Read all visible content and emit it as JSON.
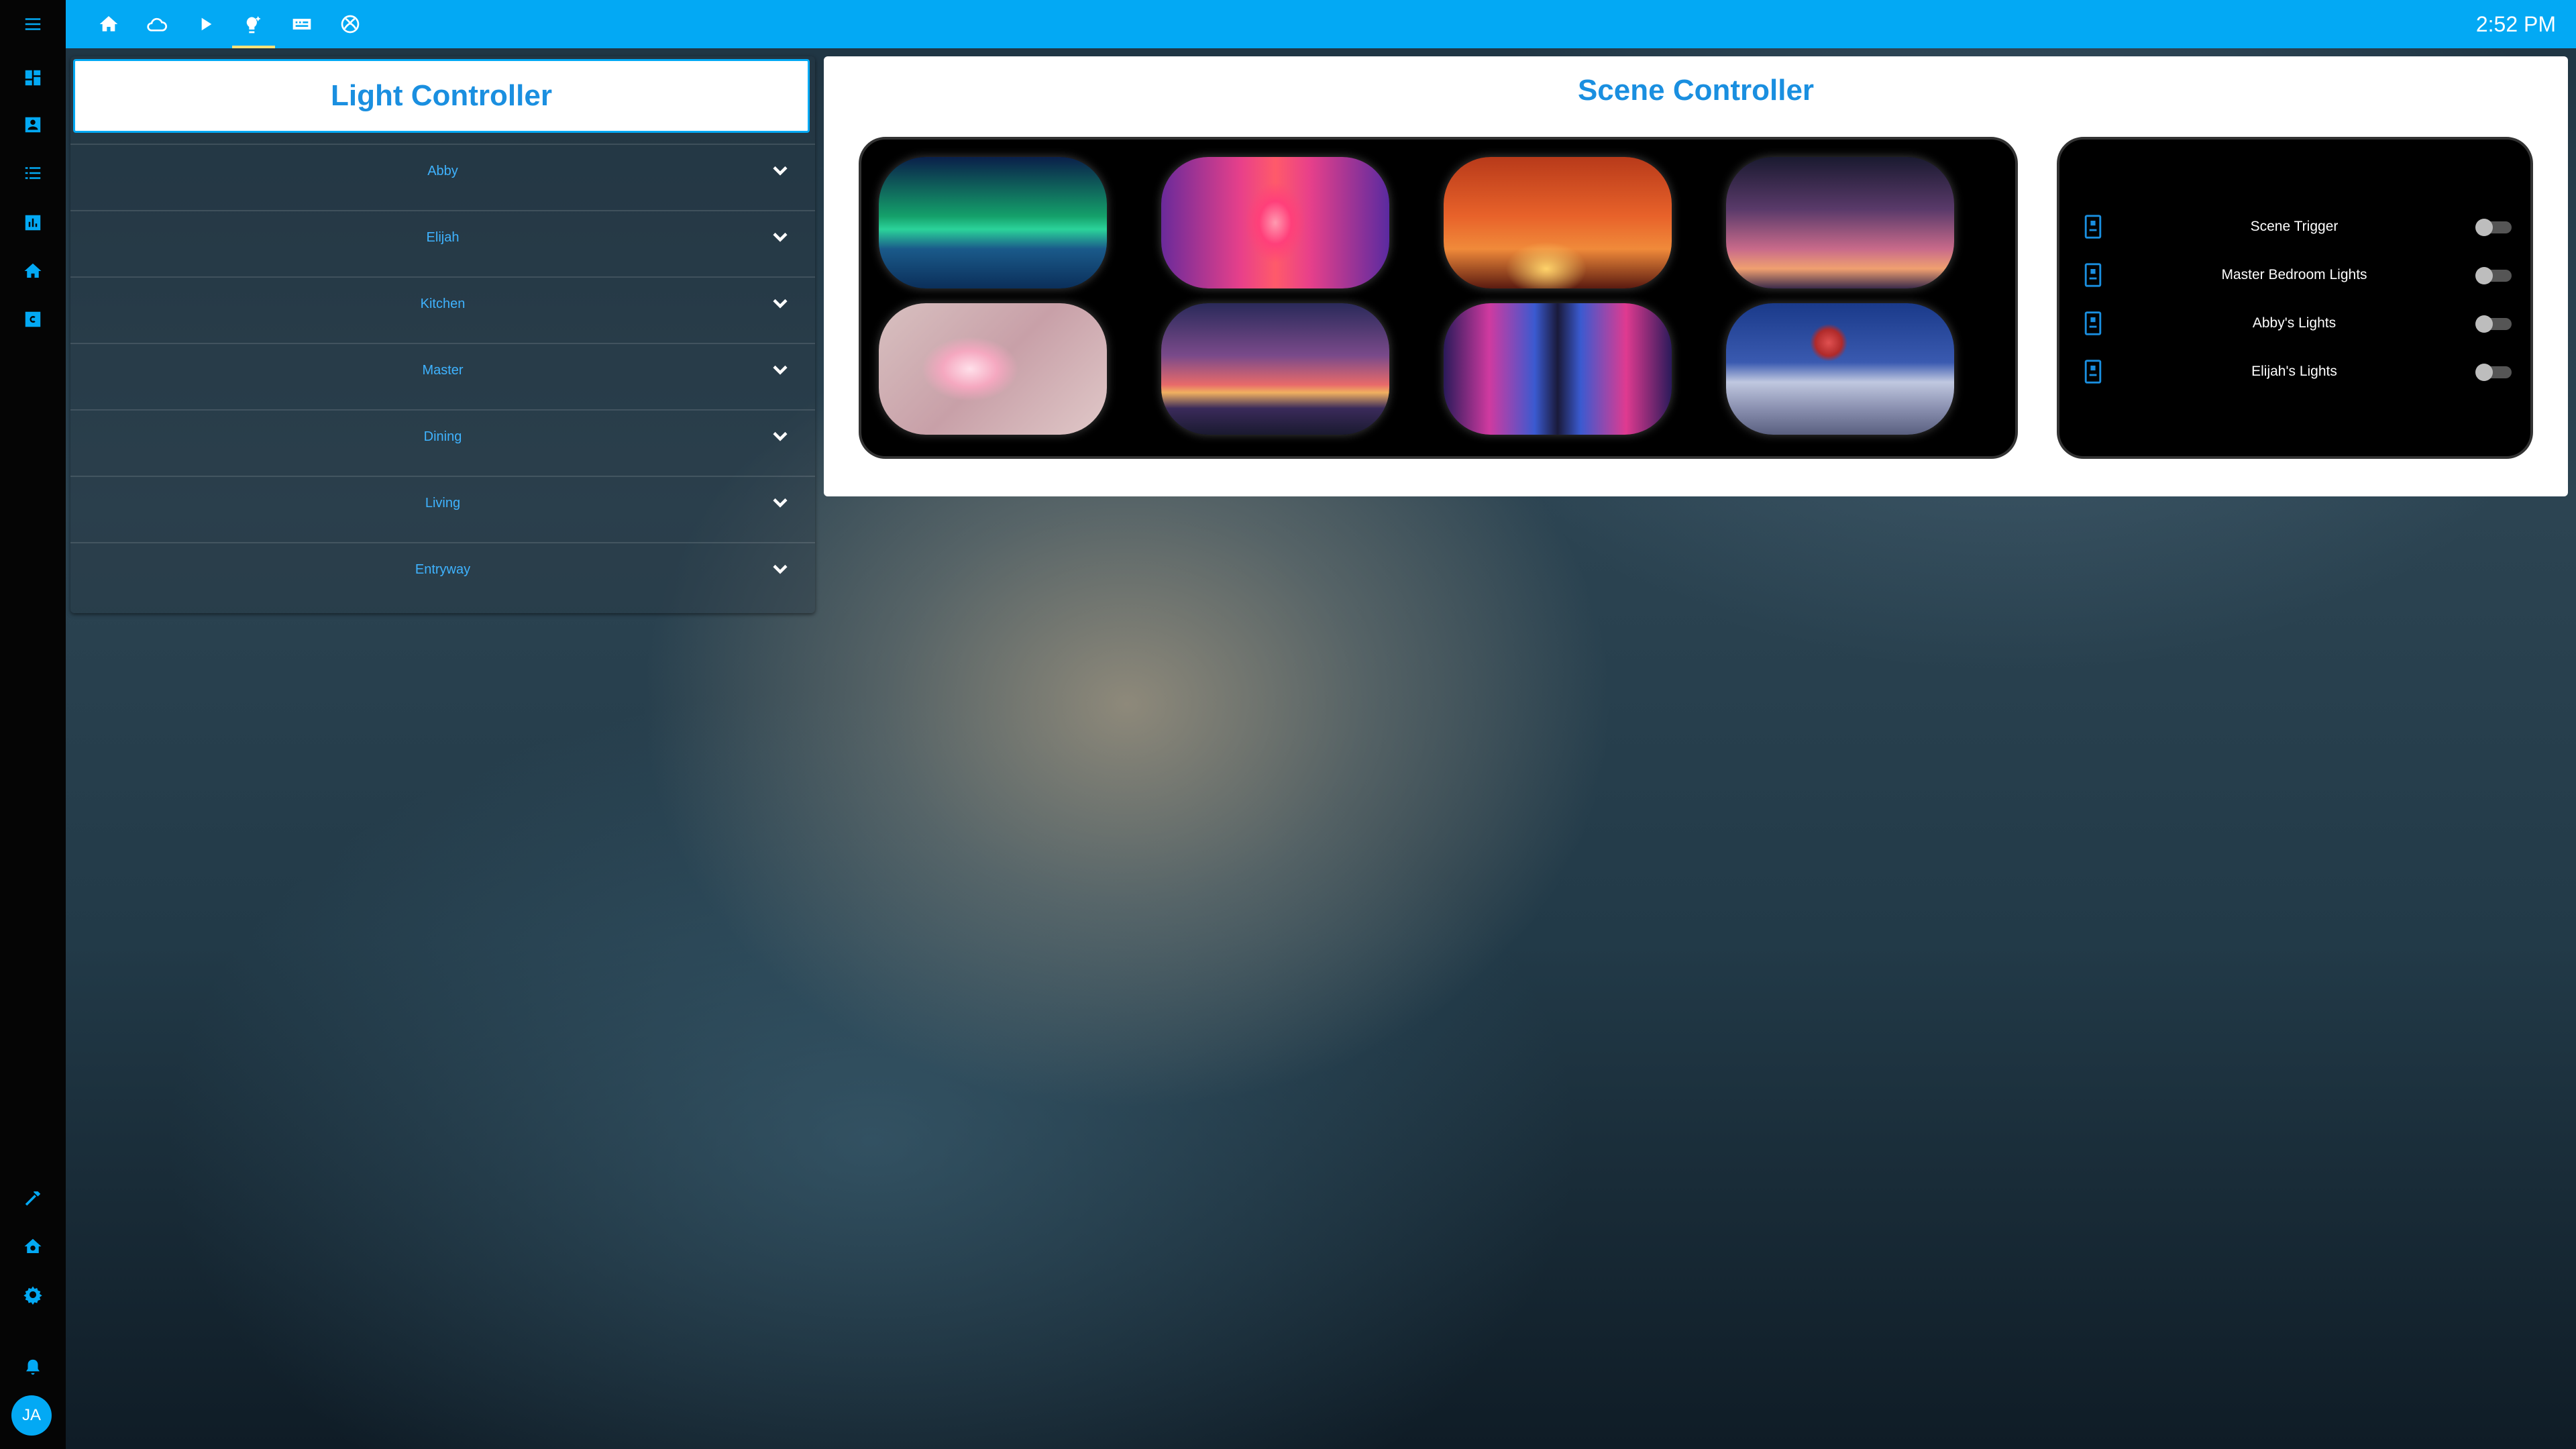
{
  "topbar": {
    "tabs": [
      {
        "icon": "home-icon"
      },
      {
        "icon": "cloud-icon"
      },
      {
        "icon": "play-icon"
      },
      {
        "icon": "lightbulb-sparkle-icon",
        "active": true
      },
      {
        "icon": "remote-icon"
      },
      {
        "icon": "xbox-icon"
      }
    ],
    "time": "2:52 PM",
    "accent_color": "#03a9f4"
  },
  "sidebar": {
    "menu_icon": "hamburger-menu-icon",
    "items": [
      {
        "icon": "dashboard-icon"
      },
      {
        "icon": "account-box-icon"
      },
      {
        "icon": "list-icon"
      },
      {
        "icon": "chart-box-icon"
      },
      {
        "icon": "home-icon"
      },
      {
        "icon": "calendar-c-icon"
      }
    ],
    "bottom_items": [
      {
        "icon": "hammer-icon"
      },
      {
        "icon": "home-gear-icon"
      },
      {
        "icon": "settings-icon"
      },
      {
        "icon": "bell-icon"
      }
    ],
    "avatar_initials": "JA"
  },
  "light_controller": {
    "title": "Light Controller",
    "rooms": [
      "Abby",
      "Elijah",
      "Kitchen",
      "Master",
      "Dining",
      "Living",
      "Entryway"
    ]
  },
  "scene_controller": {
    "title": "Scene Controller",
    "scenes": [
      {
        "name": "aurora-scene"
      },
      {
        "name": "neon-corridor-scene"
      },
      {
        "name": "savanna-sunset-scene"
      },
      {
        "name": "palm-dusk-scene"
      },
      {
        "name": "cherry-blossom-scene"
      },
      {
        "name": "beach-palms-scene"
      },
      {
        "name": "neon-city-street-scene"
      },
      {
        "name": "red-moon-mountain-scene"
      }
    ],
    "switches": [
      {
        "label": "Scene Trigger",
        "on": false
      },
      {
        "label": "Master Bedroom Lights",
        "on": false
      },
      {
        "label": "Abby's Lights",
        "on": false
      },
      {
        "label": "Elijah's Lights",
        "on": false
      }
    ]
  }
}
